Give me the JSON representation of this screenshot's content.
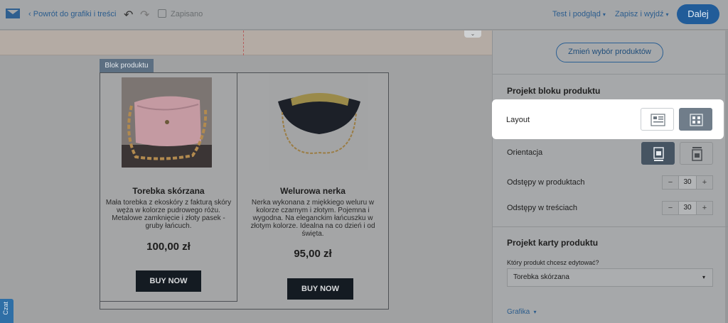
{
  "topbar": {
    "back_label": "Powrót do grafiki i treści",
    "save_status": "Zapisano",
    "test_label": "Test i podgląd",
    "save_exit_label": "Zapisz i wyjdź",
    "next_label": "Dalej"
  },
  "canvas": {
    "block_tab": "Blok produktu",
    "products": [
      {
        "name": "Torebka skórzana",
        "description": "Mała torebka z ekoskóry z fakturą skóry węża w kolorze pudrowego różu. Metalowe zamknięcie i złoty pasek - gruby łańcuch.",
        "price": "100,00 zł",
        "button": "BUY NOW"
      },
      {
        "name": "Welurowa nerka",
        "description": "Nerka wykonana z miękkiego weluru w kolorze czarnym i złotym. Pojemna i wygodna. Na eleganckim łańcuszku w złotym kolorze. Idealna na co dzień i od święta.",
        "price": "95,00 zł",
        "button": "BUY NOW"
      }
    ],
    "chat_label": "Czat"
  },
  "panel": {
    "change_products": "Zmień wybór produktów",
    "block_design_title": "Projekt bloku produktu",
    "layout_label": "Layout",
    "orientation_label": "Orientacja",
    "product_spacing_label": "Odstępy w produktach",
    "product_spacing_value": "30",
    "content_spacing_label": "Odstępy w treściach",
    "content_spacing_value": "30",
    "card_design_title": "Projekt karty produktu",
    "edit_question": "Który produkt chcesz edytować?",
    "selected_product": "Torebka skórzana",
    "grafika_label": "Grafika"
  },
  "colors": {
    "accent": "#215c99",
    "highlight": "#ffffff",
    "button_dark": "#141b22"
  }
}
